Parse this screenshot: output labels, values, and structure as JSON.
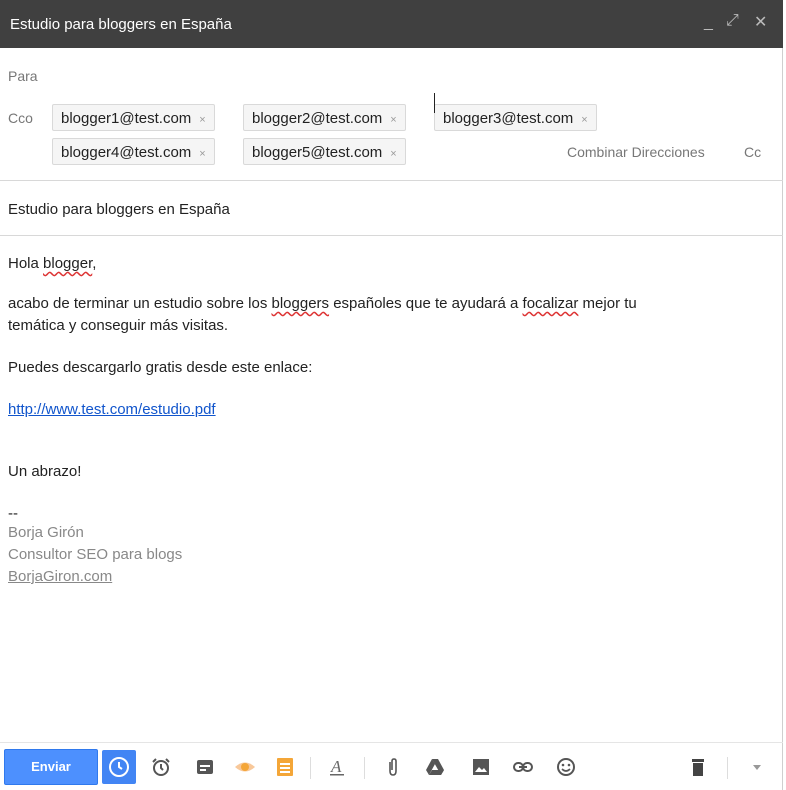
{
  "window": {
    "title": "Estudio para bloggers en España",
    "controls": {
      "minimize": "_",
      "maximize": "⤢",
      "close": "✕"
    }
  },
  "recipients": {
    "to_label": "Para",
    "bcc_label": "Cco",
    "bcc": [
      "blogger1@test.com",
      "blogger2@test.com",
      "blogger3@test.com",
      "blogger4@test.com",
      "blogger5@test.com"
    ],
    "chip_remove": "×",
    "combine_label": "Combinar Direcciones",
    "cc_label": "Cc"
  },
  "subject": "Estudio para bloggers en España",
  "body": {
    "greeting_pre": "Hola ",
    "greeting_word": "blogger",
    "greeting_post": ",",
    "p1_a": "acabo de terminar un estudio sobre los ",
    "p1_b": "bloggers",
    "p1_c": " españoles que te ayudará a ",
    "p1_d": "focalizar",
    "p1_e": " mejor tu",
    "p1_line2": "temática y conseguir más visitas.",
    "p2": "Puedes descargarlo gratis desde este enlace:",
    "link": "http://www.test.com/estudio.pdf",
    "closing": "Un abrazo!",
    "sig_sep": "--",
    "sig_name": "Borja Girón",
    "sig_role": "Consultor SEO para blogs",
    "sig_site": "BorjaGiron.com"
  },
  "toolbar": {
    "send_label": "Enviar",
    "icons": [
      "check-circle-icon",
      "alarm-clock-icon",
      "template-icon",
      "eye-icon",
      "notes-icon",
      "format-text-icon",
      "attachment-icon",
      "drive-icon",
      "image-icon",
      "link-icon",
      "emoji-icon",
      "trash-icon",
      "more-options-icon"
    ]
  },
  "colors": {
    "titlebar": "#404040",
    "send_button": "#4d90fe",
    "link": "#1155cc",
    "accent_blue": "#4285f4",
    "accent_orange": "#f4a638"
  }
}
